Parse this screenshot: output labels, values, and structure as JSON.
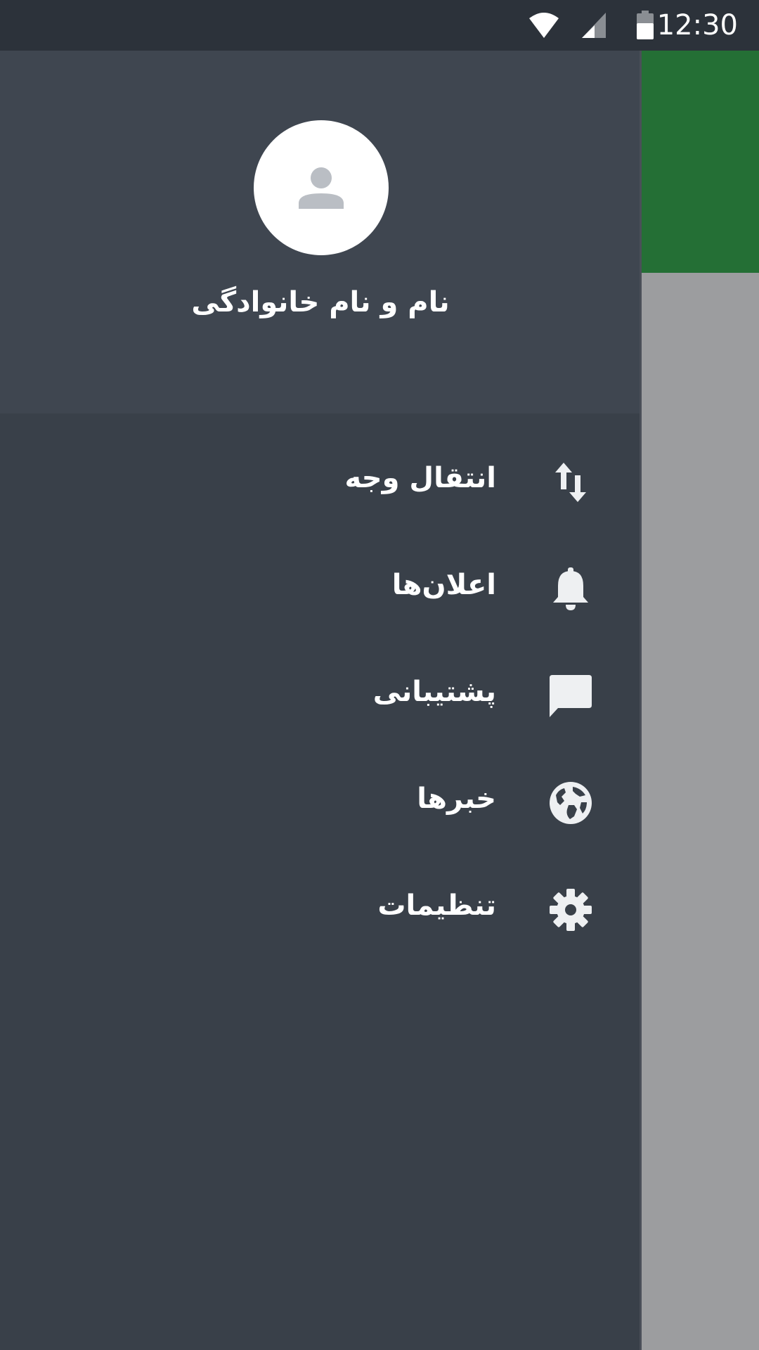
{
  "status_bar": {
    "time": "12:30",
    "icons": [
      "wifi-icon",
      "cell-signal-icon",
      "battery-icon"
    ]
  },
  "drawer": {
    "header": {
      "avatar_icon": "person-icon",
      "user_name": "نام و نام خانوادگی"
    },
    "items": [
      {
        "label": "انتقال وجه",
        "icon": "swap-vert-icon"
      },
      {
        "label": "اعلان‌ها",
        "icon": "bell-icon"
      },
      {
        "label": "پشتیبانی",
        "icon": "chat-bubble-icon"
      },
      {
        "label": "خبرها",
        "icon": "globe-icon"
      },
      {
        "label": "تنظیمات",
        "icon": "gear-icon"
      }
    ]
  },
  "colors": {
    "status_bar": "#2c323a",
    "drawer_header": "#3f4650",
    "drawer_body": "#394049",
    "toolbar_green": "#246f35",
    "scrim_content": "#9c9d9f",
    "text": "#ffffff",
    "icon": "#eef0f2"
  }
}
